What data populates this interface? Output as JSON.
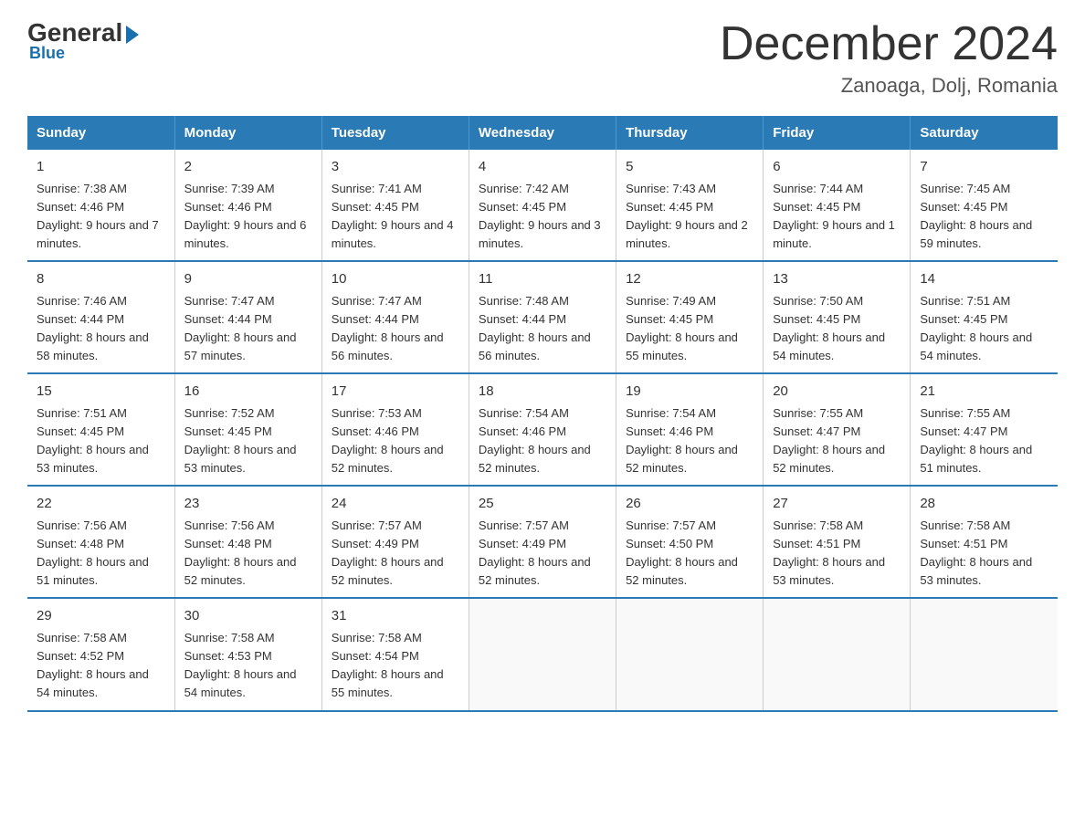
{
  "logo": {
    "general": "General",
    "blue": "Blue",
    "tagline": "Blue"
  },
  "header": {
    "title": "December 2024",
    "subtitle": "Zanoaga, Dolj, Romania"
  },
  "days_of_week": [
    "Sunday",
    "Monday",
    "Tuesday",
    "Wednesday",
    "Thursday",
    "Friday",
    "Saturday"
  ],
  "weeks": [
    [
      {
        "day": "1",
        "sunrise": "7:38 AM",
        "sunset": "4:46 PM",
        "daylight": "9 hours and 7 minutes."
      },
      {
        "day": "2",
        "sunrise": "7:39 AM",
        "sunset": "4:46 PM",
        "daylight": "9 hours and 6 minutes."
      },
      {
        "day": "3",
        "sunrise": "7:41 AM",
        "sunset": "4:45 PM",
        "daylight": "9 hours and 4 minutes."
      },
      {
        "day": "4",
        "sunrise": "7:42 AM",
        "sunset": "4:45 PM",
        "daylight": "9 hours and 3 minutes."
      },
      {
        "day": "5",
        "sunrise": "7:43 AM",
        "sunset": "4:45 PM",
        "daylight": "9 hours and 2 minutes."
      },
      {
        "day": "6",
        "sunrise": "7:44 AM",
        "sunset": "4:45 PM",
        "daylight": "9 hours and 1 minute."
      },
      {
        "day": "7",
        "sunrise": "7:45 AM",
        "sunset": "4:45 PM",
        "daylight": "8 hours and 59 minutes."
      }
    ],
    [
      {
        "day": "8",
        "sunrise": "7:46 AM",
        "sunset": "4:44 PM",
        "daylight": "8 hours and 58 minutes."
      },
      {
        "day": "9",
        "sunrise": "7:47 AM",
        "sunset": "4:44 PM",
        "daylight": "8 hours and 57 minutes."
      },
      {
        "day": "10",
        "sunrise": "7:47 AM",
        "sunset": "4:44 PM",
        "daylight": "8 hours and 56 minutes."
      },
      {
        "day": "11",
        "sunrise": "7:48 AM",
        "sunset": "4:44 PM",
        "daylight": "8 hours and 56 minutes."
      },
      {
        "day": "12",
        "sunrise": "7:49 AM",
        "sunset": "4:45 PM",
        "daylight": "8 hours and 55 minutes."
      },
      {
        "day": "13",
        "sunrise": "7:50 AM",
        "sunset": "4:45 PM",
        "daylight": "8 hours and 54 minutes."
      },
      {
        "day": "14",
        "sunrise": "7:51 AM",
        "sunset": "4:45 PM",
        "daylight": "8 hours and 54 minutes."
      }
    ],
    [
      {
        "day": "15",
        "sunrise": "7:51 AM",
        "sunset": "4:45 PM",
        "daylight": "8 hours and 53 minutes."
      },
      {
        "day": "16",
        "sunrise": "7:52 AM",
        "sunset": "4:45 PM",
        "daylight": "8 hours and 53 minutes."
      },
      {
        "day": "17",
        "sunrise": "7:53 AM",
        "sunset": "4:46 PM",
        "daylight": "8 hours and 52 minutes."
      },
      {
        "day": "18",
        "sunrise": "7:54 AM",
        "sunset": "4:46 PM",
        "daylight": "8 hours and 52 minutes."
      },
      {
        "day": "19",
        "sunrise": "7:54 AM",
        "sunset": "4:46 PM",
        "daylight": "8 hours and 52 minutes."
      },
      {
        "day": "20",
        "sunrise": "7:55 AM",
        "sunset": "4:47 PM",
        "daylight": "8 hours and 52 minutes."
      },
      {
        "day": "21",
        "sunrise": "7:55 AM",
        "sunset": "4:47 PM",
        "daylight": "8 hours and 51 minutes."
      }
    ],
    [
      {
        "day": "22",
        "sunrise": "7:56 AM",
        "sunset": "4:48 PM",
        "daylight": "8 hours and 51 minutes."
      },
      {
        "day": "23",
        "sunrise": "7:56 AM",
        "sunset": "4:48 PM",
        "daylight": "8 hours and 52 minutes."
      },
      {
        "day": "24",
        "sunrise": "7:57 AM",
        "sunset": "4:49 PM",
        "daylight": "8 hours and 52 minutes."
      },
      {
        "day": "25",
        "sunrise": "7:57 AM",
        "sunset": "4:49 PM",
        "daylight": "8 hours and 52 minutes."
      },
      {
        "day": "26",
        "sunrise": "7:57 AM",
        "sunset": "4:50 PM",
        "daylight": "8 hours and 52 minutes."
      },
      {
        "day": "27",
        "sunrise": "7:58 AM",
        "sunset": "4:51 PM",
        "daylight": "8 hours and 53 minutes."
      },
      {
        "day": "28",
        "sunrise": "7:58 AM",
        "sunset": "4:51 PM",
        "daylight": "8 hours and 53 minutes."
      }
    ],
    [
      {
        "day": "29",
        "sunrise": "7:58 AM",
        "sunset": "4:52 PM",
        "daylight": "8 hours and 54 minutes."
      },
      {
        "day": "30",
        "sunrise": "7:58 AM",
        "sunset": "4:53 PM",
        "daylight": "8 hours and 54 minutes."
      },
      {
        "day": "31",
        "sunrise": "7:58 AM",
        "sunset": "4:54 PM",
        "daylight": "8 hours and 55 minutes."
      },
      null,
      null,
      null,
      null
    ]
  ]
}
